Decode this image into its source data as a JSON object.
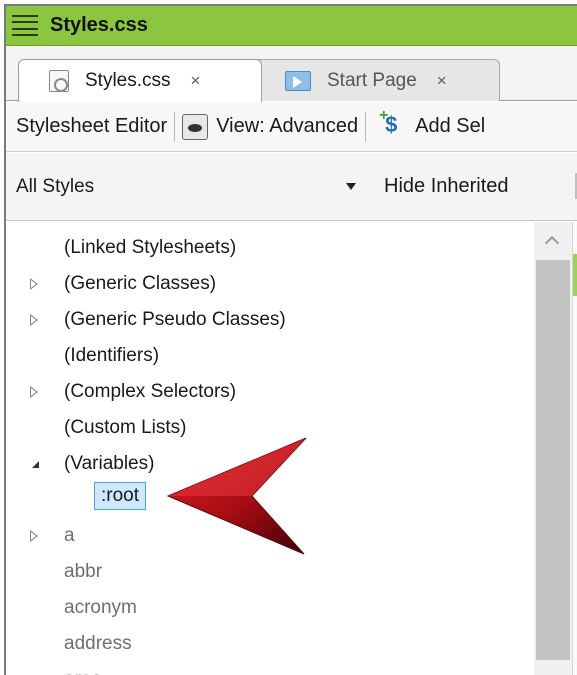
{
  "window": {
    "title": "Styles.css"
  },
  "tabs": [
    {
      "label": "Styles.css",
      "close": "×",
      "active": true
    },
    {
      "label": "Start Page",
      "close": "×",
      "active": false
    }
  ],
  "toolbar": {
    "editor_label": "Stylesheet Editor",
    "view_label": "View: Advanced",
    "add_label": "Add Sel"
  },
  "filter": {
    "selected": "All Styles",
    "hide_inherited": "Hide Inherited"
  },
  "tree": {
    "items": [
      {
        "label": "(Linked Stylesheets)",
        "expander": "none"
      },
      {
        "label": "(Generic Classes)",
        "expander": "closed"
      },
      {
        "label": "(Generic Pseudo Classes)",
        "expander": "closed"
      },
      {
        "label": "(Identifiers)",
        "expander": "none"
      },
      {
        "label": "(Complex Selectors)",
        "expander": "closed"
      },
      {
        "label": "(Custom Lists)",
        "expander": "none"
      },
      {
        "label": "(Variables)",
        "expander": "open"
      },
      {
        "label": ":root",
        "expander": "none",
        "selected": true
      },
      {
        "label": "a",
        "expander": "closed"
      },
      {
        "label": "abbr",
        "expander": "none"
      },
      {
        "label": "acronym",
        "expander": "none"
      },
      {
        "label": "address",
        "expander": "none"
      },
      {
        "label": "area",
        "expander": "none"
      }
    ]
  },
  "colors": {
    "titlebar": "#8cc63f",
    "selection_bg": "#cde8ff",
    "selection_border": "#4a9fe0",
    "annotation_arrow": "#c0141c"
  },
  "icons": {
    "menu": "hamburger-icon",
    "tab1": "stylesheet-doc-icon",
    "tab2": "start-page-icon",
    "view": "view-eye-icon",
    "add": "add-selector-icon",
    "dropdown": "dropdown-caret-icon"
  }
}
